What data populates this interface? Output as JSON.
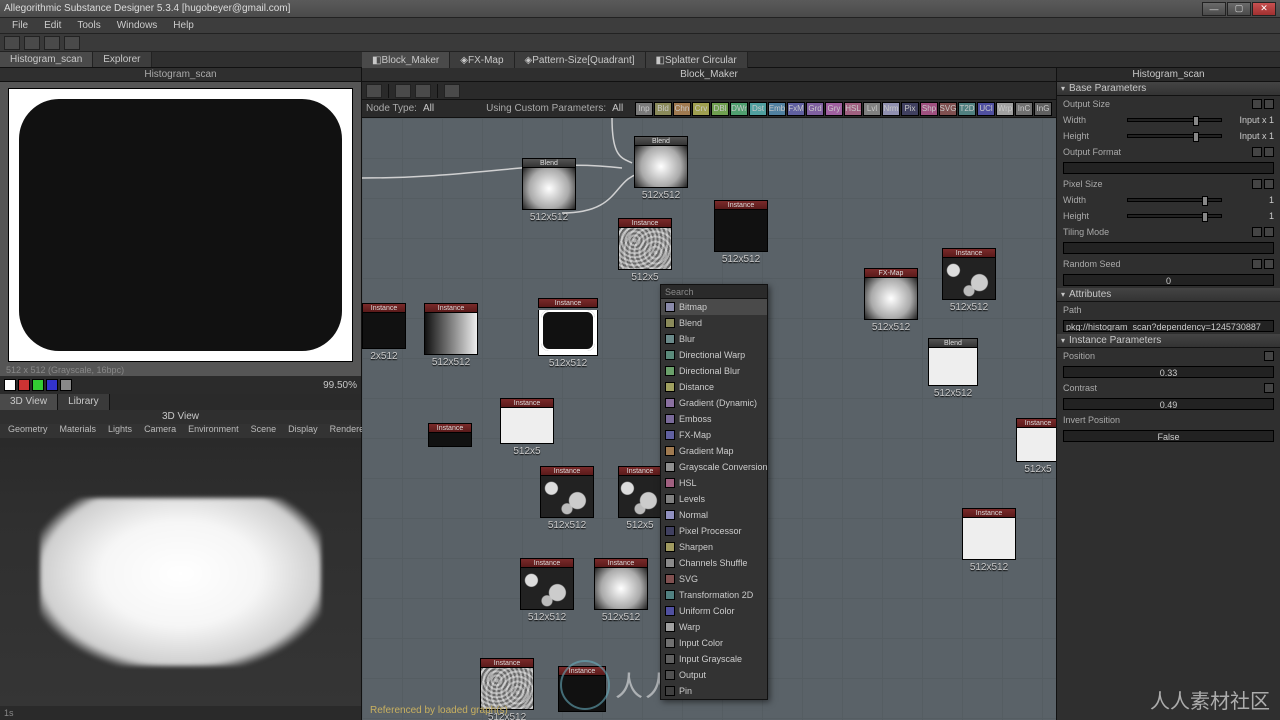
{
  "titlebar": {
    "title": "Allegorithmic Substance Designer 5.3.4 [hugobeyer@gmail.com]"
  },
  "menubar": [
    "File",
    "Edit",
    "Tools",
    "Windows",
    "Help"
  ],
  "tabs_top": [
    {
      "label": "Histogram_scan",
      "active": true
    },
    {
      "label": "Explorer",
      "active": false
    }
  ],
  "left": {
    "preview2d_title": "Histogram_scan",
    "preview2d_caption": "512 x 512 (Grayscale, 16bpc)",
    "zoom": "99.50%  ",
    "tabs3d": [
      {
        "label": "3D View",
        "active": true
      },
      {
        "label": "Library",
        "active": false
      }
    ],
    "panel3d_title": "3D View",
    "menu3d": [
      "Geometry",
      "Materials",
      "Lights",
      "Camera",
      "Environment",
      "Scene",
      "Display",
      "Renderer"
    ],
    "status3d": "1s"
  },
  "center": {
    "graph_tabs": [
      {
        "label": "Block_Maker",
        "icon": "graph"
      },
      {
        "label": "FX-Map",
        "icon": "fx"
      },
      {
        "label": "Pattern-Size[Quadrant]",
        "icon": "fx"
      },
      {
        "label": "Splatter Circular",
        "icon": "graph"
      }
    ],
    "header": "Block_Maker",
    "filter": {
      "node_type_lbl": "Node Type:",
      "node_type_val": "All",
      "using_lbl": "Using Custom Parameters:",
      "using_val": "All"
    },
    "chips": [
      {
        "t": "Inp",
        "c": "#7a7a7a"
      },
      {
        "t": "Bld",
        "c": "#8a8a5a"
      },
      {
        "t": "Chn",
        "c": "#a07a50"
      },
      {
        "t": "Crv",
        "c": "#a0a050"
      },
      {
        "t": "DBl",
        "c": "#70a050"
      },
      {
        "t": "DWr",
        "c": "#50a070"
      },
      {
        "t": "Dst",
        "c": "#50a0a0"
      },
      {
        "t": "Emb",
        "c": "#5080a0"
      },
      {
        "t": "FxM",
        "c": "#6060a0"
      },
      {
        "t": "Grd",
        "c": "#8060a0"
      },
      {
        "t": "Gry",
        "c": "#a060a0"
      },
      {
        "t": "HSL",
        "c": "#a06080"
      },
      {
        "t": "Lvl",
        "c": "#808080"
      },
      {
        "t": "Nrm",
        "c": "#9090b0"
      },
      {
        "t": "Pix",
        "c": "#404060"
      },
      {
        "t": "Shp",
        "c": "#a05080"
      },
      {
        "t": "SVG",
        "c": "#805050"
      },
      {
        "t": "T2D",
        "c": "#508080"
      },
      {
        "t": "UCl",
        "c": "#5050a0"
      },
      {
        "t": "Wrp",
        "c": "#a0a0a0"
      },
      {
        "t": "InC",
        "c": "#707070"
      },
      {
        "t": "InG",
        "c": "#606060"
      }
    ],
    "footer": "Referenced by loaded graph(s)",
    "res": "512x512",
    "res2": "2x512",
    "res3": "512x5"
  },
  "context_menu": {
    "search": "Search",
    "items": [
      {
        "label": "Bitmap",
        "c": "#8a8aaa",
        "sel": true
      },
      {
        "label": "Blend",
        "c": "#8a8a5a"
      },
      {
        "label": "Blur",
        "c": "#6a8a8a"
      },
      {
        "label": "Directional Warp",
        "c": "#5a8a7a"
      },
      {
        "label": "Directional Blur",
        "c": "#6aa06a"
      },
      {
        "label": "Distance",
        "c": "#a0a060"
      },
      {
        "label": "Gradient (Dynamic)",
        "c": "#8a70a0"
      },
      {
        "label": "Emboss",
        "c": "#7a6a9a"
      },
      {
        "label": "FX-Map",
        "c": "#6060a0"
      },
      {
        "label": "Gradient Map",
        "c": "#a07a50"
      },
      {
        "label": "Grayscale Conversion",
        "c": "#909090"
      },
      {
        "label": "HSL",
        "c": "#a06080"
      },
      {
        "label": "Levels",
        "c": "#808080"
      },
      {
        "label": "Normal",
        "c": "#9090c0"
      },
      {
        "label": "Pixel Processor",
        "c": "#404060"
      },
      {
        "label": "Sharpen",
        "c": "#a09a60"
      },
      {
        "label": "Channels Shuffle",
        "c": "#8a8a8a"
      },
      {
        "label": "SVG",
        "c": "#805050"
      },
      {
        "label": "Transformation 2D",
        "c": "#508080"
      },
      {
        "label": "Uniform Color",
        "c": "#5050a0"
      },
      {
        "label": "Warp",
        "c": "#a0a0a0"
      },
      {
        "label": "Input Color",
        "c": "#707070"
      },
      {
        "label": "Input Grayscale",
        "c": "#606060"
      },
      {
        "label": "Output",
        "c": "#505050"
      },
      {
        "label": "Pin",
        "c": "#404040"
      }
    ]
  },
  "right": {
    "tab": "Histogram_scan",
    "sections": {
      "base": "Base Parameters",
      "output_size": "Output Size",
      "width": "Width",
      "width_v": "Input x 1",
      "height": "Height",
      "height_v": "Input x 1",
      "output_format": "Output Format",
      "output_format_v": "",
      "pixel_size": "Pixel Size",
      "p_width": "Width",
      "p_width_v": "1",
      "p_height": "Height",
      "p_height_v": "1",
      "tiling": "Tiling Mode",
      "tiling_v": "",
      "random": "Random Seed",
      "random_v": "0",
      "attributes": "Attributes",
      "path_k": "Path",
      "path_v": "pkg://histogram_scan?dependency=1245730887",
      "instance": "Instance Parameters",
      "position_k": "Position",
      "position_v": "0.33",
      "contrast_k": "Contrast",
      "contrast_v": "0.49",
      "invert_k": "Invert Position",
      "invert_v": "False"
    }
  },
  "watermark_big": "人人素材",
  "watermark_right": "人人素材社区"
}
